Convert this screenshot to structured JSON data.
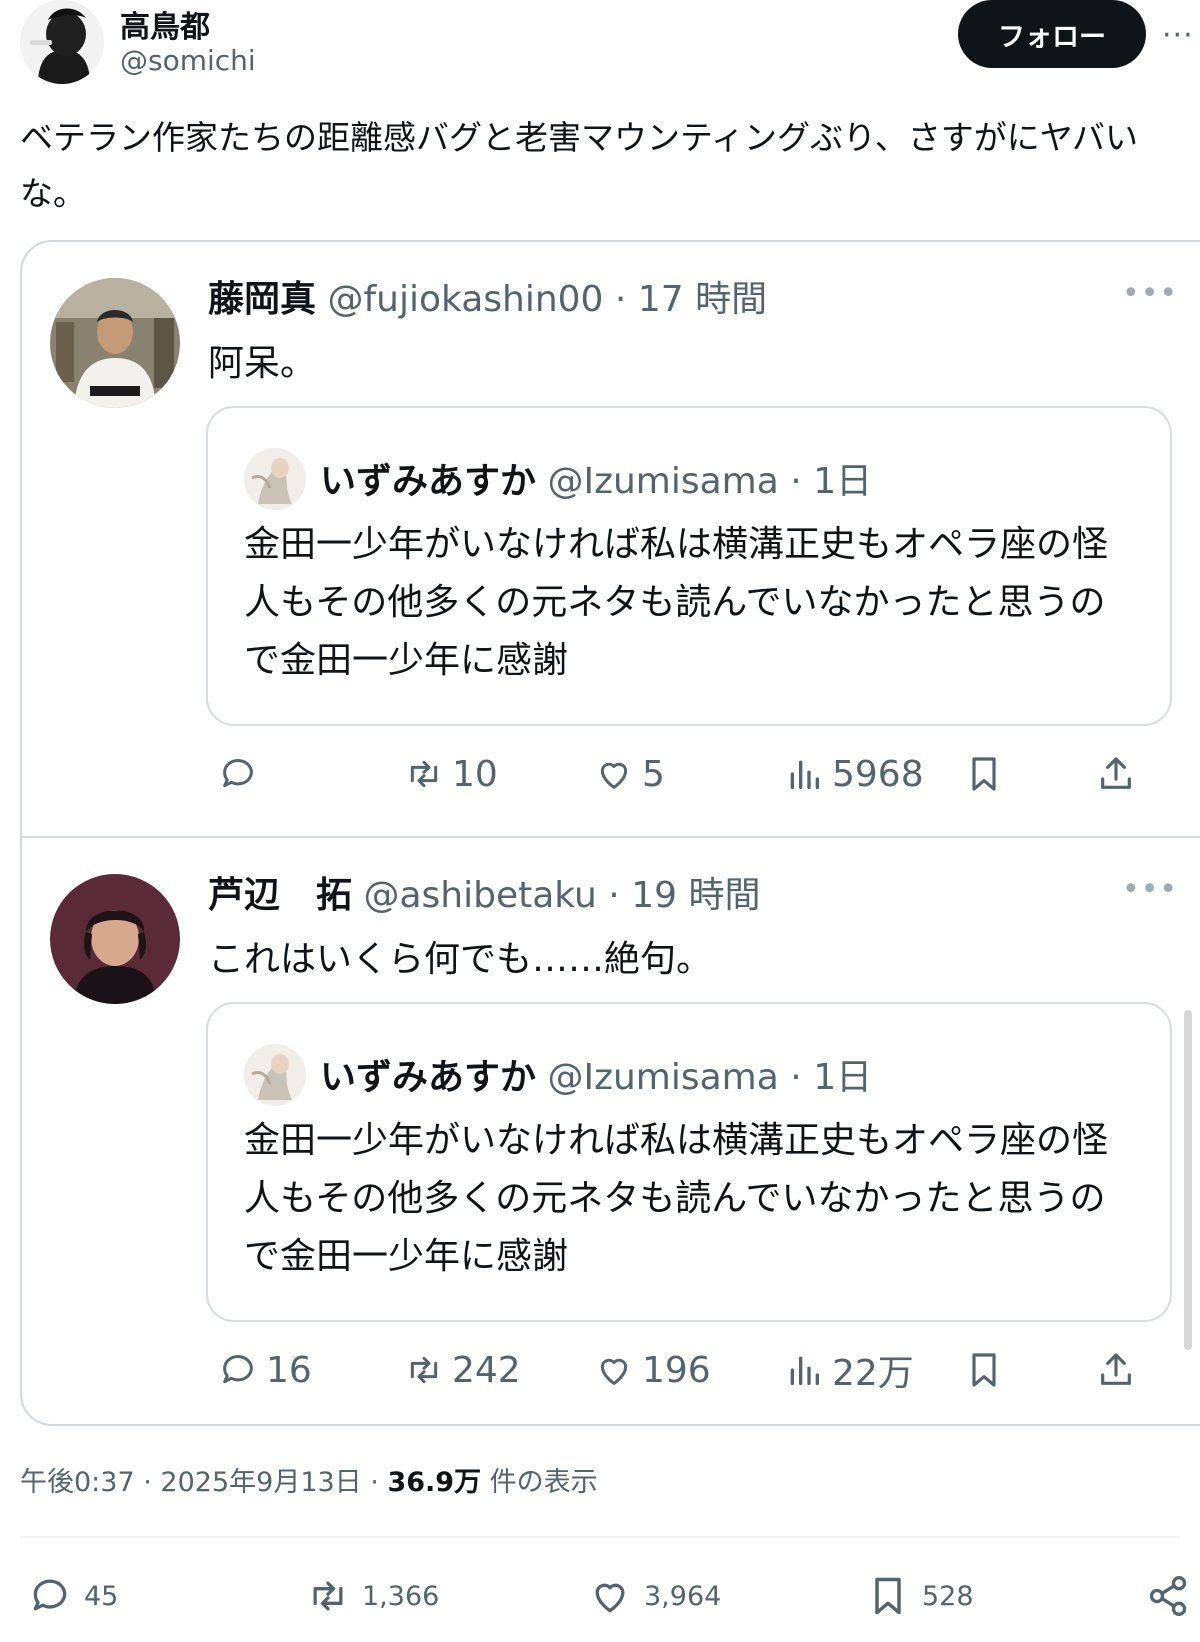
{
  "author": {
    "name": "高鳥都",
    "handle": "@somichi",
    "follow_label": "フォロー",
    "more": "···"
  },
  "tweet": {
    "text": "ベテラン作家たちの距離感バグと老害マウンティングぶり、さすがにヤバいな。"
  },
  "replies": [
    {
      "name": "藤岡真",
      "handle": "@fujiokashin00",
      "sep": "·",
      "time": "17 時間",
      "text": "阿呆。",
      "more": "•••",
      "quote": {
        "name": "いずみあすか",
        "handle": "@Izumisama",
        "sep": "·",
        "time": "1日",
        "text": "金田一少年がいなければ私は横溝正史もオペラ座の怪人もその他多くの元ネタも読んでいなかったと思うので金田一少年に感謝"
      },
      "actions": {
        "replies": "",
        "retweets": "10",
        "likes": "5",
        "views": "5968"
      }
    },
    {
      "name": "芦辺　拓",
      "handle": "@ashibetaku",
      "sep": "·",
      "time": "19 時間",
      "text": "これはいくら何でも……絶句。",
      "more": "•••",
      "quote": {
        "name": "いずみあすか",
        "handle": "@Izumisama",
        "sep": "·",
        "time": "1日",
        "text": "金田一少年がいなければ私は横溝正史もオペラ座の怪人もその他多くの元ネタも読んでいなかったと思うので金田一少年に感謝"
      },
      "actions": {
        "replies": "16",
        "retweets": "242",
        "likes": "196",
        "views": "22万"
      }
    }
  ],
  "meta": {
    "time": "午後0:37",
    "sep": "·",
    "date": "2025年9月13日",
    "views_count": "36.9万",
    "views_label": "件の表示"
  },
  "stats": {
    "replies": "45",
    "retweets": "1,366",
    "likes": "3,964",
    "bookmarks": "528"
  },
  "icons": [
    "reply-icon",
    "retweet-icon",
    "like-icon",
    "views-icon",
    "bookmark-icon",
    "share-icon",
    "share-network-icon"
  ],
  "colors": {
    "text": "#0f1419",
    "secondary": "#536471",
    "border": "#cfd9de",
    "button": "#0f1419"
  }
}
